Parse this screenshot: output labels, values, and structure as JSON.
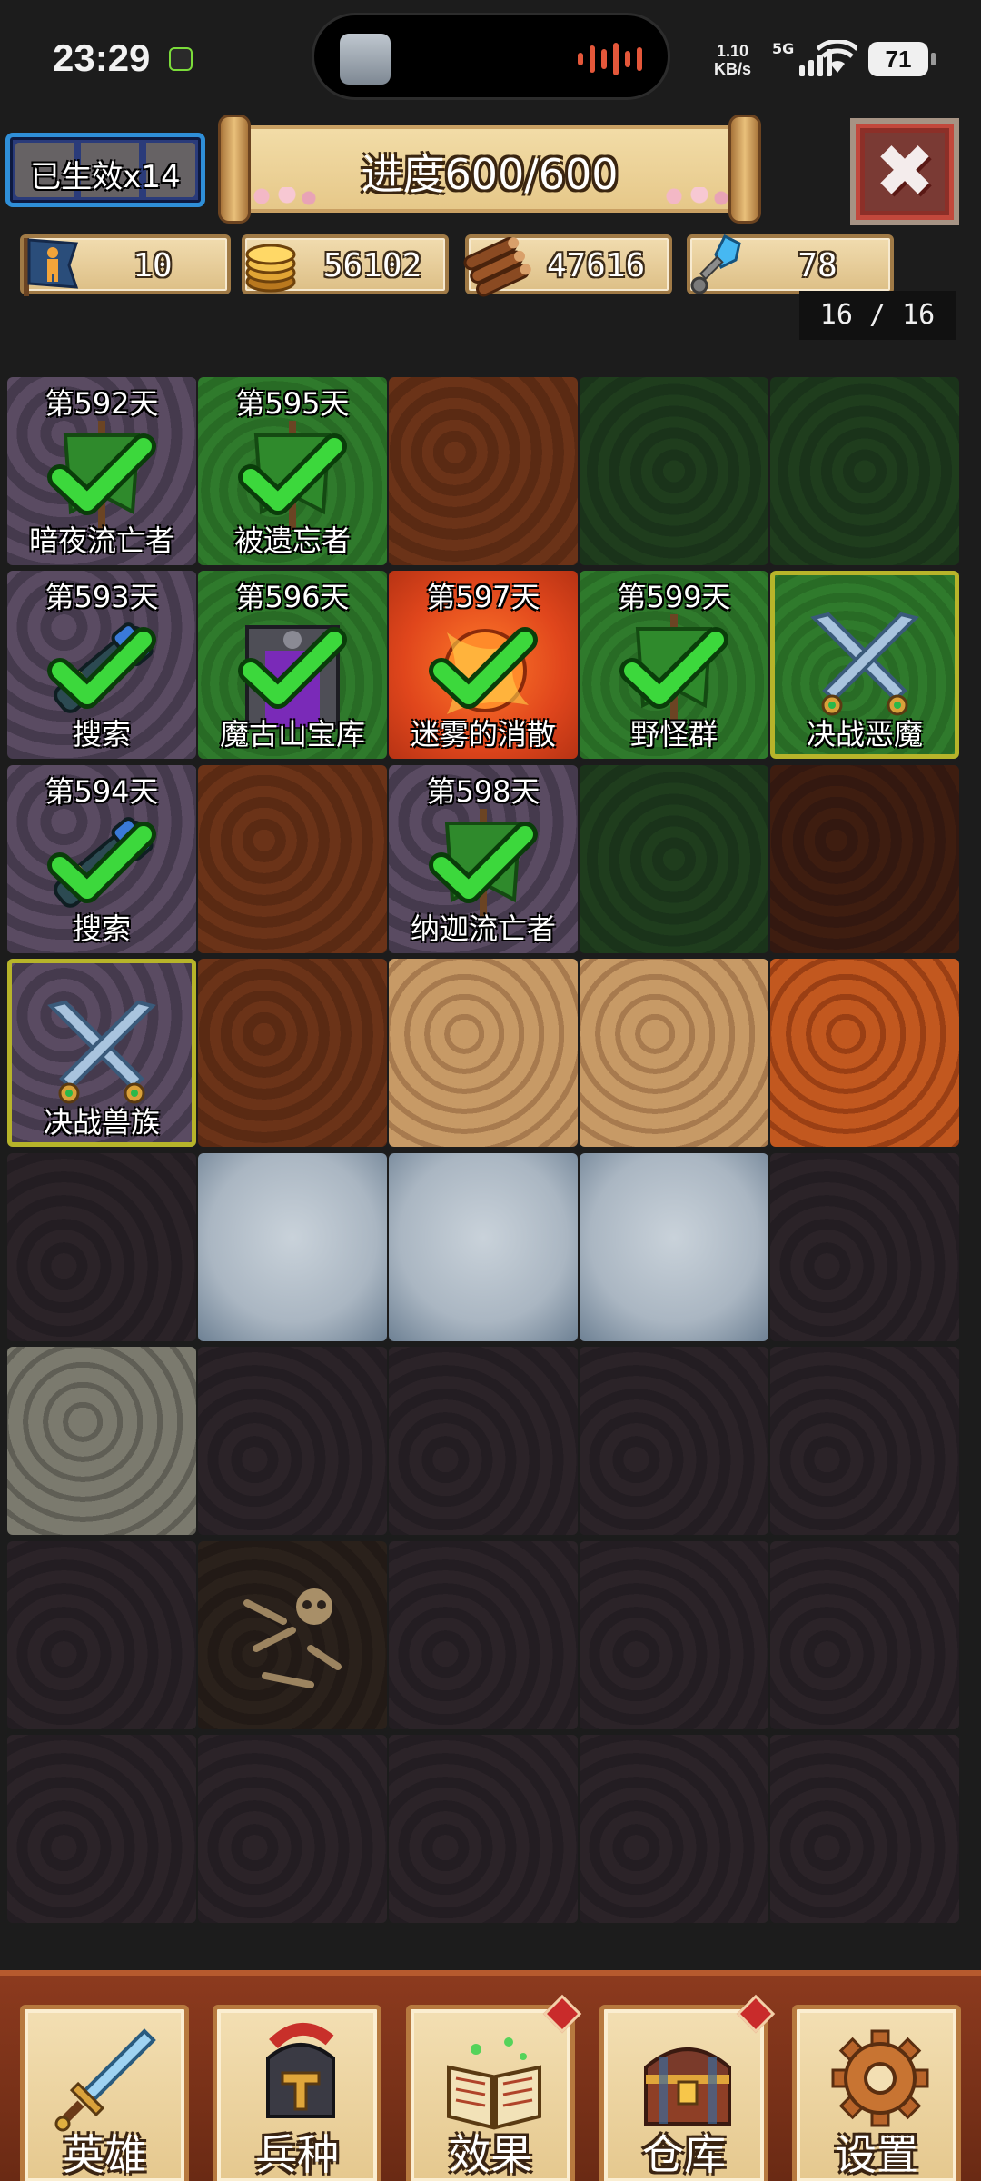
{
  "status": {
    "time": "23:29",
    "net_speed": "1.10",
    "net_unit": "KB/s",
    "signal_label": "5G",
    "battery": "71"
  },
  "header": {
    "lives_label": "已生效x14",
    "progress": "进度600/600",
    "close_icon": "close-icon"
  },
  "resources": [
    {
      "icon": "population-icon",
      "value": "10"
    },
    {
      "icon": "gold-coins-icon",
      "value": "56102"
    },
    {
      "icon": "wood-logs-icon",
      "value": "47616"
    },
    {
      "icon": "crystal-key-icon",
      "value": "78"
    }
  ],
  "counter": "16 / 16",
  "board": [
    [
      {
        "terrain": "stone",
        "day": "第592天",
        "name": "暗夜流亡者",
        "icon": "banner-check-icon"
      },
      {
        "terrain": "grass",
        "day": "第595天",
        "name": "被遗忘者",
        "icon": "banner-check-icon"
      },
      {
        "terrain": "dirt"
      },
      {
        "terrain": "darkgrass"
      },
      {
        "terrain": "darkgrass"
      }
    ],
    [
      {
        "terrain": "stone",
        "day": "第593天",
        "name": "搜索",
        "icon": "telescope-check-icon"
      },
      {
        "terrain": "grass",
        "day": "第596天",
        "name": "魔古山宝库",
        "icon": "portal-check-icon"
      },
      {
        "terrain": "lava",
        "day": "第597天",
        "name": "迷雾的消散",
        "icon": "fireball-check-icon"
      },
      {
        "terrain": "grass",
        "day": "第599天",
        "name": "野怪群",
        "icon": "banner-check-icon"
      },
      {
        "terrain": "grass",
        "name": "决战恶魔",
        "icon": "crossed-swords-icon",
        "selected": true
      }
    ],
    [
      {
        "terrain": "stone",
        "day": "第594天",
        "name": "搜索",
        "icon": "telescope-check-icon"
      },
      {
        "terrain": "dirt"
      },
      {
        "terrain": "stone",
        "day": "第598天",
        "name": "纳迦流亡者",
        "icon": "banner-check-icon"
      },
      {
        "terrain": "darkgrass"
      },
      {
        "terrain": "darkdirt"
      }
    ],
    [
      {
        "terrain": "stone",
        "name": "决战兽族",
        "icon": "crossed-swords-icon",
        "selected": true
      },
      {
        "terrain": "dirt"
      },
      {
        "terrain": "sand"
      },
      {
        "terrain": "sand"
      },
      {
        "terrain": "orange"
      }
    ],
    [
      {
        "terrain": "rock"
      },
      {
        "terrain": "snow"
      },
      {
        "terrain": "snow"
      },
      {
        "terrain": "snow"
      },
      {
        "terrain": "rock"
      }
    ],
    [
      {
        "terrain": "cobble"
      },
      {
        "terrain": "rock"
      },
      {
        "terrain": "rock"
      },
      {
        "terrain": "rock"
      },
      {
        "terrain": "rock"
      }
    ],
    [
      {
        "terrain": "rock"
      },
      {
        "terrain": "bones",
        "icon": "skull-bones-icon"
      },
      {
        "terrain": "rock"
      },
      {
        "terrain": "rock"
      },
      {
        "terrain": "rock"
      }
    ],
    [
      {
        "terrain": "rock"
      },
      {
        "terrain": "rock"
      },
      {
        "terrain": "rock"
      },
      {
        "terrain": "rock"
      },
      {
        "terrain": "rock"
      }
    ]
  ],
  "nav": [
    {
      "label": "英雄",
      "icon": "sword-icon",
      "badge": false
    },
    {
      "label": "兵种",
      "icon": "helmet-icon",
      "badge": false
    },
    {
      "label": "效果",
      "icon": "spellbook-icon",
      "badge": true
    },
    {
      "label": "仓库",
      "icon": "treasure-chest-icon",
      "badge": true
    },
    {
      "label": "设置",
      "icon": "gear-icon",
      "badge": false
    }
  ]
}
